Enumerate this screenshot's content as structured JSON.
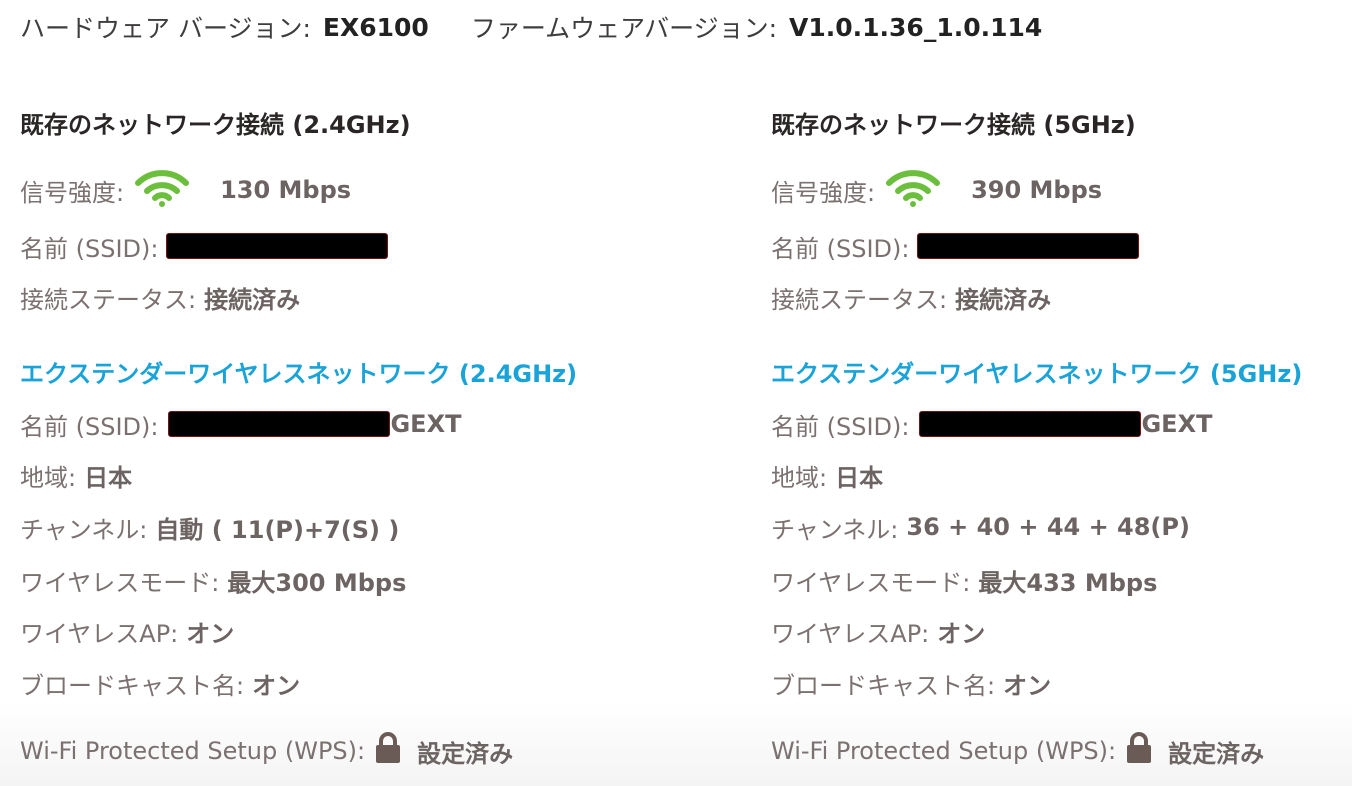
{
  "header": {
    "hardware_label": "ハードウェア バージョン:",
    "hardware_value": "EX6100",
    "firmware_label": "ファームウェアバージョン:",
    "firmware_value": "V1.0.1.36_1.0.114"
  },
  "columns": [
    {
      "existing_title": "既存のネットワーク接続 (2.4GHz)",
      "signal_label": "信号強度:",
      "signal_rate": "130 Mbps",
      "ssid_label": "名前 (SSID):",
      "status_label": "接続ステータス:",
      "status_value": "接続済み",
      "extender_title": "エクステンダーワイヤレスネットワーク (2.4GHz)",
      "ext_ssid_label": "名前 (SSID):",
      "ext_ssid_suffix": "GEXT",
      "region_label": "地域:",
      "region_value": "日本",
      "channel_label": "チャンネル:",
      "channel_value": "自動 ( 11(P)+7(S) )",
      "mode_label": "ワイヤレスモード:",
      "mode_value": "最大300 Mbps",
      "ap_label": "ワイヤレスAP:",
      "ap_value": "オン",
      "broadcast_label": "ブロードキャスト名:",
      "broadcast_value": "オン",
      "wps_label": "Wi-Fi Protected Setup (WPS):",
      "wps_value": "設定済み"
    },
    {
      "existing_title": "既存のネットワーク接続 (5GHz)",
      "signal_label": "信号強度:",
      "signal_rate": "390 Mbps",
      "ssid_label": "名前 (SSID):",
      "status_label": "接続ステータス:",
      "status_value": "接続済み",
      "extender_title": "エクステンダーワイヤレスネットワーク (5GHz)",
      "ext_ssid_label": "名前 (SSID):",
      "ext_ssid_suffix": "GEXT",
      "region_label": "地域:",
      "region_value": "日本",
      "channel_label": "チャンネル:",
      "channel_value": "36 + 40 + 44 + 48(P)",
      "mode_label": "ワイヤレスモード:",
      "mode_value": "最大433 Mbps",
      "ap_label": "ワイヤレスAP:",
      "ap_value": "オン",
      "broadcast_label": "ブロードキャスト名:",
      "broadcast_value": "オン",
      "wps_label": "Wi-Fi Protected Setup (WPS):",
      "wps_value": "設定済み"
    }
  ],
  "colors": {
    "accent_blue": "#1aa3d8",
    "wifi_green": "#6cbf3d",
    "lock_brown": "#6b5b57"
  },
  "icons": {
    "signal": "wifi-signal-icon",
    "wps": "lock-icon"
  }
}
